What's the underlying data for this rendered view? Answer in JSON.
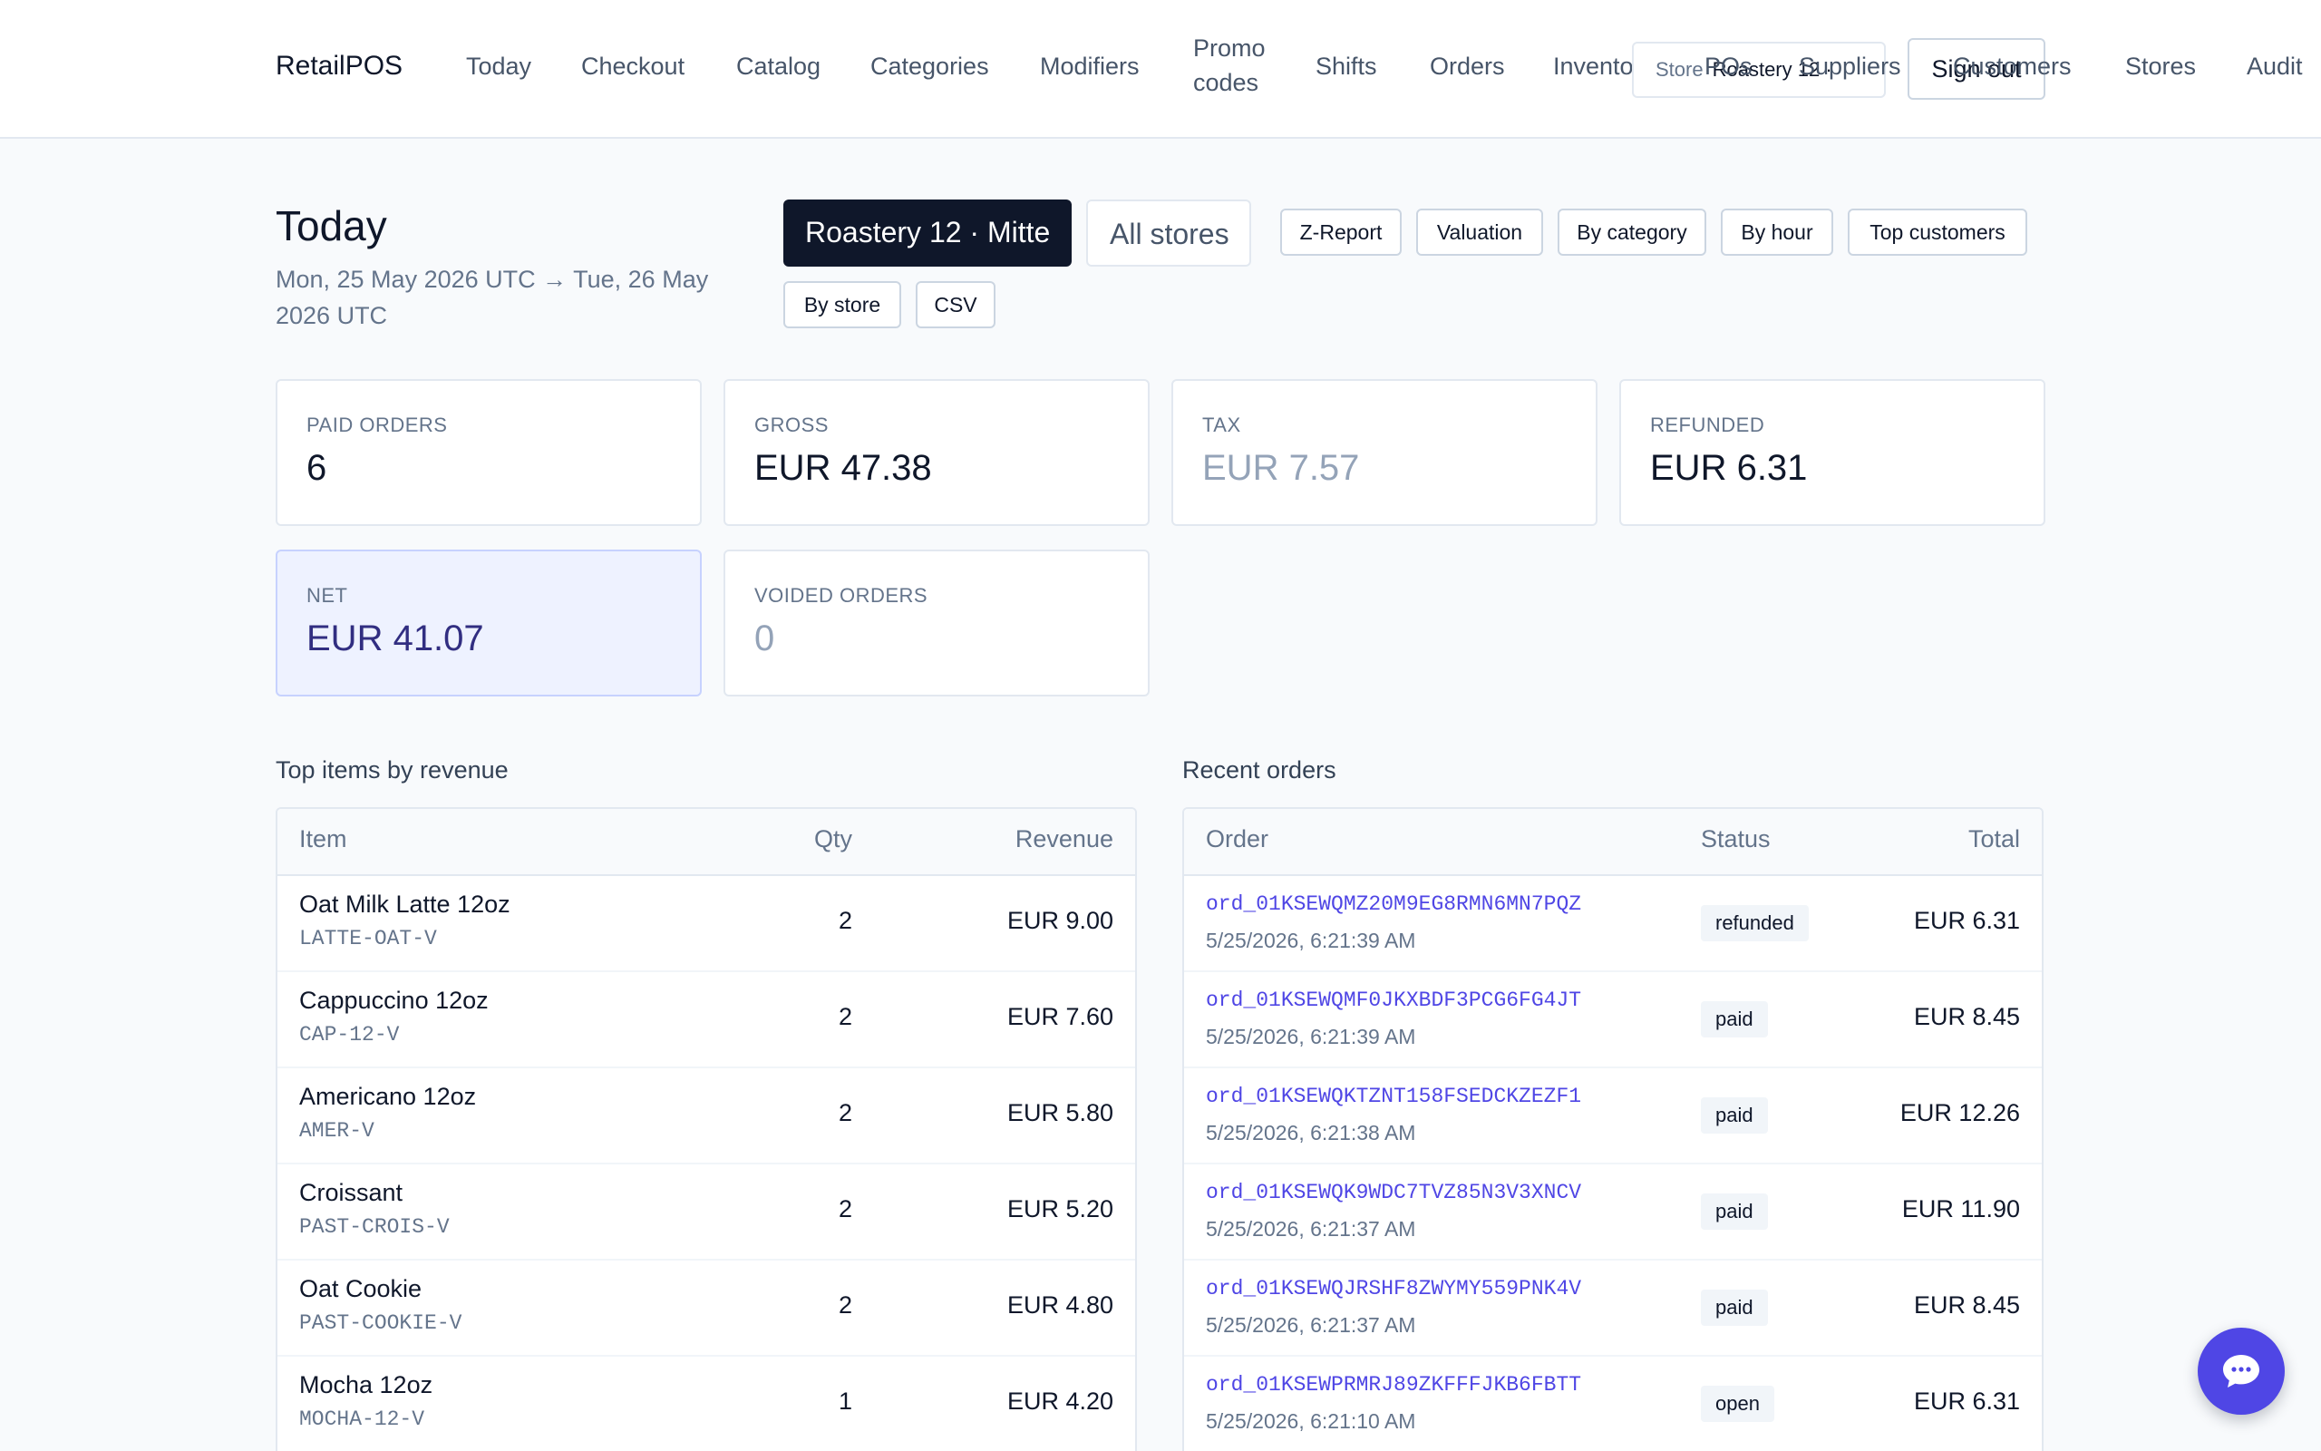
{
  "brand": "RetailPOS",
  "nav": {
    "items": [
      "Today",
      "Checkout",
      "Catalog",
      "Categories",
      "Modifiers",
      "Promo codes",
      "Shifts",
      "Orders",
      "Inventory",
      "POs",
      "Suppliers",
      "Customers",
      "Stores",
      "Audit"
    ]
  },
  "store_select": {
    "label": "Store",
    "value": "Roastery 12 · "
  },
  "signout_label": "Sign out",
  "header": {
    "title": "Today",
    "date_range": "Mon, 25 May 2026 UTC → Tue, 26 May 2026 UTC",
    "store_active": "Roastery 12 · Mitte",
    "store_all": "All stores"
  },
  "reports": [
    "Z-Report",
    "Valuation",
    "By category",
    "By hour",
    "Top customers",
    "By store",
    "CSV"
  ],
  "stats": [
    {
      "label": "Paid orders",
      "value": "6"
    },
    {
      "label": "Gross",
      "value": "EUR 47.38"
    },
    {
      "label": "Tax",
      "value": "EUR 7.57"
    },
    {
      "label": "Refunded",
      "value": "EUR 6.31"
    },
    {
      "label": "Net",
      "value": "EUR 41.07"
    },
    {
      "label": "Voided orders",
      "value": "0"
    }
  ],
  "top_items": {
    "title": "Top items by revenue",
    "columns": [
      "Item",
      "Qty",
      "Revenue"
    ],
    "rows": [
      {
        "name": "Oat Milk Latte 12oz",
        "sku": "LATTE-OAT-V",
        "qty": "2",
        "revenue": "EUR 9.00"
      },
      {
        "name": "Cappuccino 12oz",
        "sku": "CAP-12-V",
        "qty": "2",
        "revenue": "EUR 7.60"
      },
      {
        "name": "Americano 12oz",
        "sku": "AMER-V",
        "qty": "2",
        "revenue": "EUR 5.80"
      },
      {
        "name": "Croissant",
        "sku": "PAST-CROIS-V",
        "qty": "2",
        "revenue": "EUR 5.20"
      },
      {
        "name": "Oat Cookie",
        "sku": "PAST-COOKIE-V",
        "qty": "2",
        "revenue": "EUR 4.80"
      },
      {
        "name": "Mocha 12oz",
        "sku": "MOCHA-12-V",
        "qty": "1",
        "revenue": "EUR 4.20"
      }
    ]
  },
  "recent_orders": {
    "title": "Recent orders",
    "columns": [
      "Order",
      "Status",
      "Total"
    ],
    "rows": [
      {
        "id": "ord_01KSEWQMZ20M9EG8RMN6MN7PQZ",
        "time": "5/25/2026, 6:21:39 AM",
        "status": "refunded",
        "total": "EUR 6.31"
      },
      {
        "id": "ord_01KSEWQMF0JKXBDF3PCG6FG4JT",
        "time": "5/25/2026, 6:21:39 AM",
        "status": "paid",
        "total": "EUR 8.45"
      },
      {
        "id": "ord_01KSEWQKTZNT158FSEDCKZEZF1",
        "time": "5/25/2026, 6:21:38 AM",
        "status": "paid",
        "total": "EUR 12.26"
      },
      {
        "id": "ord_01KSEWQK9WDC7TVZ85N3V3XNCV",
        "time": "5/25/2026, 6:21:37 AM",
        "status": "paid",
        "total": "EUR 11.90"
      },
      {
        "id": "ord_01KSEWQJRSHF8ZWYMY559PNK4V",
        "time": "5/25/2026, 6:21:37 AM",
        "status": "paid",
        "total": "EUR 8.45"
      },
      {
        "id": "ord_01KSEWPRMRJ89ZKFFFJKB6FBTT",
        "time": "5/25/2026, 6:21:10 AM",
        "status": "open",
        "total": "EUR 6.31"
      }
    ]
  },
  "chat": {
    "icon": "chat-bubble-icon"
  },
  "colors": {
    "accent": "#4f46e5",
    "dark": "#0f172a",
    "muted": "#64748b"
  }
}
